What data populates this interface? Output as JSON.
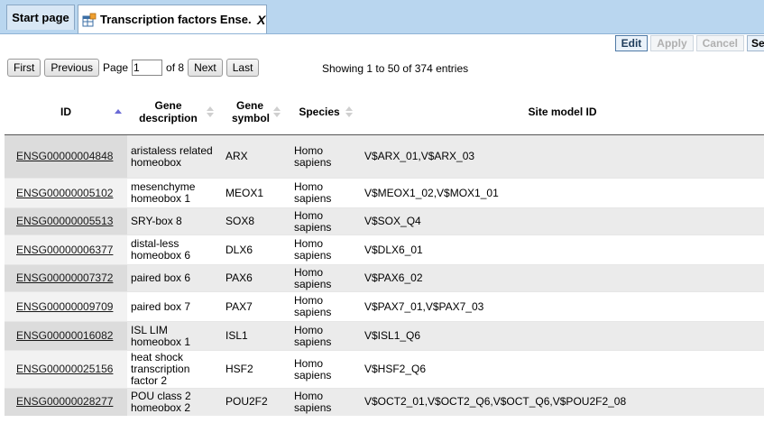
{
  "tabs": {
    "start_label": "Start page",
    "active_label": "Transcription factors Ense...",
    "close_glyph": "X"
  },
  "toolbar": {
    "edit_label": "Edit",
    "apply_label": "Apply",
    "cancel_label": "Cancel",
    "select_label": "Se"
  },
  "pager": {
    "first_label": "First",
    "previous_label": "Previous",
    "page_label": "Page",
    "page_value": "1",
    "of_label": "of 8",
    "next_label": "Next",
    "last_label": "Last",
    "showing_text": "Showing 1 to 50 of 374 entries"
  },
  "table": {
    "headers": {
      "id": "ID",
      "gene_description": "Gene description",
      "gene_symbol": "Gene symbol",
      "species": "Species",
      "site_model_id": "Site model ID"
    },
    "sorted_column": "ID",
    "sort_direction": "ascending",
    "rows": [
      {
        "id": "ENSG00000004848",
        "desc": "aristaless related homeobox",
        "symbol": "ARX",
        "species": "Homo sapiens",
        "site": "V$ARX_01,V$ARX_03"
      },
      {
        "id": "ENSG00000005102",
        "desc": "mesenchyme homeobox 1",
        "symbol": "MEOX1",
        "species": "Homo sapiens",
        "site": "V$MEOX1_02,V$MOX1_01"
      },
      {
        "id": "ENSG00000005513",
        "desc": "SRY-box 8",
        "symbol": "SOX8",
        "species": "Homo sapiens",
        "site": "V$SOX_Q4"
      },
      {
        "id": "ENSG00000006377",
        "desc": "distal-less homeobox 6",
        "symbol": "DLX6",
        "species": "Homo sapiens",
        "site": "V$DLX6_01"
      },
      {
        "id": "ENSG00000007372",
        "desc": "paired box 6",
        "symbol": "PAX6",
        "species": "Homo sapiens",
        "site": "V$PAX6_02"
      },
      {
        "id": "ENSG00000009709",
        "desc": "paired box 7",
        "symbol": "PAX7",
        "species": "Homo sapiens",
        "site": "V$PAX7_01,V$PAX7_03"
      },
      {
        "id": "ENSG00000016082",
        "desc": "ISL LIM homeobox 1",
        "symbol": "ISL1",
        "species": "Homo sapiens",
        "site": "V$ISL1_Q6"
      },
      {
        "id": "ENSG00000025156",
        "desc": "heat shock transcription factor 2",
        "symbol": "HSF2",
        "species": "Homo sapiens",
        "site": "V$HSF2_Q6"
      },
      {
        "id": "ENSG00000028277",
        "desc": "POU class 2 homeobox 2",
        "symbol": "POU2F2",
        "species": "Homo sapiens",
        "site": "V$OCT2_01,V$OCT2_Q6,V$OCT_Q6,V$POU2F2_08"
      }
    ]
  },
  "colors": {
    "tabbar_bg": "#b9d6ef",
    "odd_row_bg": "#ebebeb",
    "sort_active": "#6b6bd6"
  }
}
